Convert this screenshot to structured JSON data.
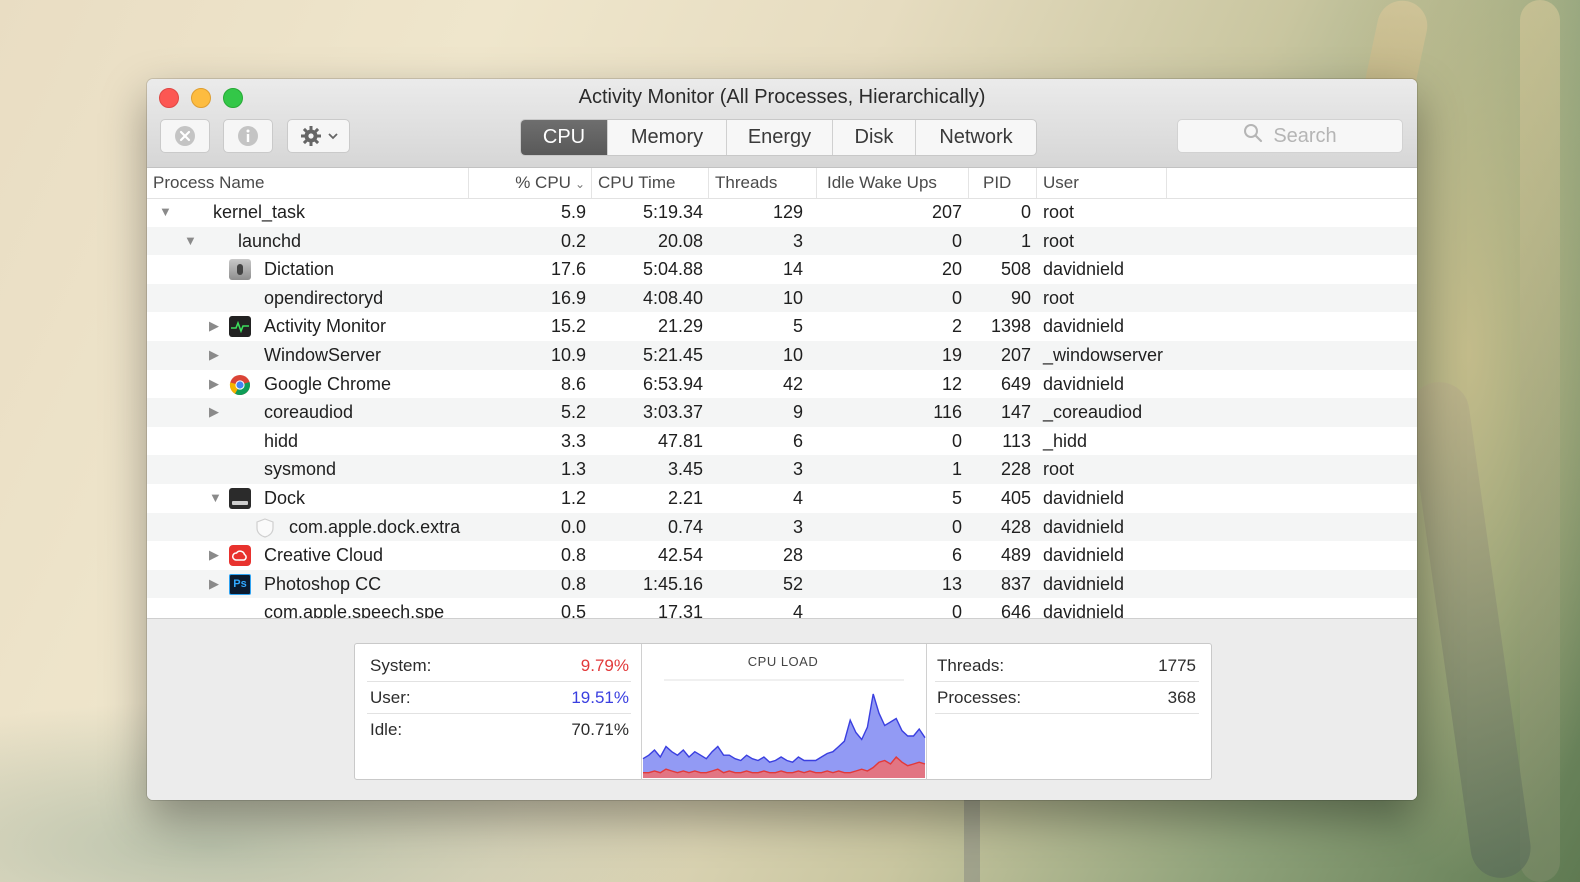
{
  "window": {
    "title": "Activity Monitor (All Processes, Hierarchically)"
  },
  "toolbar": {
    "tabs": [
      {
        "label": "CPU",
        "active": true
      },
      {
        "label": "Memory",
        "active": false
      },
      {
        "label": "Energy",
        "active": false
      },
      {
        "label": "Disk",
        "active": false
      },
      {
        "label": "Network",
        "active": false
      }
    ],
    "search_placeholder": "Search"
  },
  "table": {
    "columns": [
      "Process Name",
      "% CPU",
      "CPU Time",
      "Threads",
      "Idle Wake Ups",
      "PID",
      "User"
    ],
    "sort_column": "% CPU",
    "rows": [
      {
        "name": "kernel_task",
        "depth": 0,
        "disclosure": "expanded",
        "icon": "",
        "cpu": "5.9",
        "time": "5:19.34",
        "threads": "129",
        "wakeups": "207",
        "pid": "0",
        "user": "root"
      },
      {
        "name": "launchd",
        "depth": 1,
        "disclosure": "expanded",
        "icon": "",
        "cpu": "0.2",
        "time": "20.08",
        "threads": "3",
        "wakeups": "0",
        "pid": "1",
        "user": "root"
      },
      {
        "name": "Dictation",
        "depth": 2,
        "disclosure": "none",
        "icon": "dictation-icon",
        "cpu": "17.6",
        "time": "5:04.88",
        "threads": "14",
        "wakeups": "20",
        "pid": "508",
        "user": "davidnield"
      },
      {
        "name": "opendirectoryd",
        "depth": 2,
        "disclosure": "none",
        "icon": "",
        "cpu": "16.9",
        "time": "4:08.40",
        "threads": "10",
        "wakeups": "0",
        "pid": "90",
        "user": "root"
      },
      {
        "name": "Activity Monitor",
        "depth": 2,
        "disclosure": "collapsed",
        "icon": "activity-monitor-icon",
        "cpu": "15.2",
        "time": "21.29",
        "threads": "5",
        "wakeups": "2",
        "pid": "1398",
        "user": "davidnield"
      },
      {
        "name": "WindowServer",
        "depth": 2,
        "disclosure": "collapsed",
        "icon": "",
        "cpu": "10.9",
        "time": "5:21.45",
        "threads": "10",
        "wakeups": "19",
        "pid": "207",
        "user": "_windowserver"
      },
      {
        "name": "Google Chrome",
        "depth": 2,
        "disclosure": "collapsed",
        "icon": "chrome-icon",
        "cpu": "8.6",
        "time": "6:53.94",
        "threads": "42",
        "wakeups": "12",
        "pid": "649",
        "user": "davidnield"
      },
      {
        "name": "coreaudiod",
        "depth": 2,
        "disclosure": "collapsed",
        "icon": "",
        "cpu": "5.2",
        "time": "3:03.37",
        "threads": "9",
        "wakeups": "116",
        "pid": "147",
        "user": "_coreaudiod"
      },
      {
        "name": "hidd",
        "depth": 2,
        "disclosure": "none",
        "icon": "",
        "cpu": "3.3",
        "time": "47.81",
        "threads": "6",
        "wakeups": "0",
        "pid": "113",
        "user": "_hidd"
      },
      {
        "name": "sysmond",
        "depth": 2,
        "disclosure": "none",
        "icon": "",
        "cpu": "1.3",
        "time": "3.45",
        "threads": "3",
        "wakeups": "1",
        "pid": "228",
        "user": "root"
      },
      {
        "name": "Dock",
        "depth": 2,
        "disclosure": "expanded",
        "icon": "dock-icon",
        "cpu": "1.2",
        "time": "2.21",
        "threads": "4",
        "wakeups": "5",
        "pid": "405",
        "user": "davidnield"
      },
      {
        "name": "com.apple.dock.extra",
        "depth": 3,
        "disclosure": "none",
        "icon": "shield-outline-icon",
        "cpu": "0.0",
        "time": "0.74",
        "threads": "3",
        "wakeups": "0",
        "pid": "428",
        "user": "davidnield"
      },
      {
        "name": "Creative Cloud",
        "depth": 2,
        "disclosure": "collapsed",
        "icon": "creative-cloud-icon",
        "cpu": "0.8",
        "time": "42.54",
        "threads": "28",
        "wakeups": "6",
        "pid": "489",
        "user": "davidnield"
      },
      {
        "name": "Photoshop CC",
        "depth": 2,
        "disclosure": "collapsed",
        "icon": "photoshop-icon",
        "cpu": "0.8",
        "time": "1:45.16",
        "threads": "52",
        "wakeups": "13",
        "pid": "837",
        "user": "davidnield"
      },
      {
        "name": "com.apple.speech.spe",
        "depth": 2,
        "disclosure": "none",
        "icon": "",
        "cpu": "0.5",
        "time": "17.31",
        "threads": "4",
        "wakeups": "0",
        "pid": "646",
        "user": "davidnield"
      }
    ]
  },
  "summary": {
    "system_label": "System:",
    "system_value": "9.79%",
    "user_label": "User:",
    "user_value": "19.51%",
    "idle_label": "Idle:",
    "idle_value": "70.71%",
    "cpu_load_title": "CPU LOAD",
    "threads_label": "Threads:",
    "threads_value": "1775",
    "processes_label": "Processes:",
    "processes_value": "368",
    "colors": {
      "system": "#e2393a",
      "user": "#3a3fe0"
    }
  },
  "cpu_load_history": {
    "system": [
      3,
      3,
      4,
      3,
      5,
      4,
      3,
      4,
      3,
      4,
      3,
      3,
      4,
      5,
      3,
      4,
      3,
      3,
      4,
      3,
      3,
      4,
      3,
      3,
      4,
      3,
      3,
      4,
      3,
      4,
      3,
      3,
      4,
      3,
      4,
      3,
      3,
      4,
      5,
      4,
      6,
      9,
      10,
      8,
      12,
      9,
      7,
      8,
      9,
      8
    ],
    "user": [
      8,
      10,
      12,
      9,
      13,
      11,
      10,
      12,
      9,
      11,
      10,
      8,
      11,
      13,
      10,
      9,
      8,
      7,
      9,
      8,
      7,
      8,
      6,
      7,
      8,
      7,
      6,
      8,
      7,
      6,
      7,
      9,
      10,
      12,
      14,
      18,
      30,
      22,
      17,
      25,
      42,
      28,
      20,
      24,
      22,
      18,
      17,
      16,
      19,
      15
    ]
  }
}
